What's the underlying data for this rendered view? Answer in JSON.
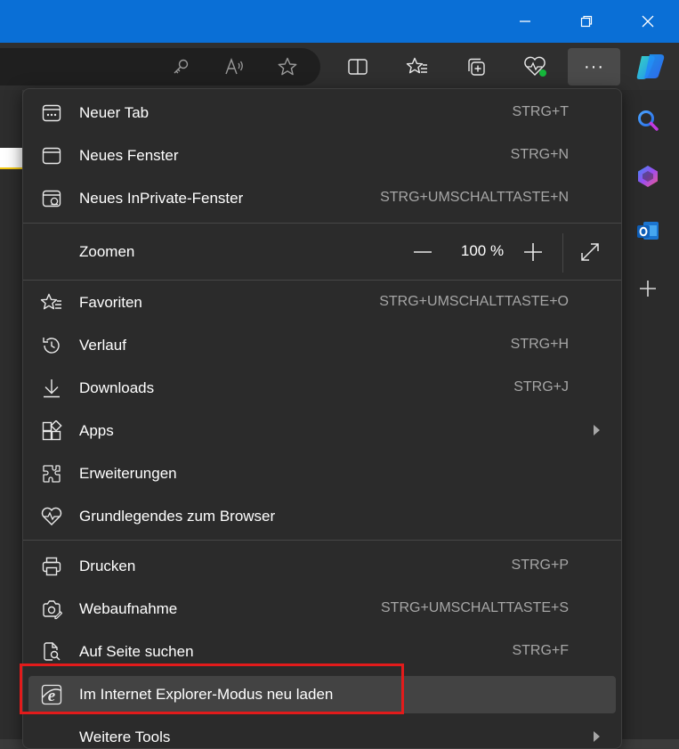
{
  "window": {
    "controls": [
      {
        "name": "minimize-icon"
      },
      {
        "name": "restore-icon"
      },
      {
        "name": "close-icon"
      }
    ]
  },
  "toolbar": {
    "address_icons": [
      "key-icon",
      "read-aloud-icon",
      "favorite-star-icon"
    ],
    "icons": [
      "split-screen-icon",
      "favorites-icon",
      "collections-icon",
      "browser-essentials-icon"
    ],
    "more_label": "···"
  },
  "sidebar": {
    "icons": [
      "copilot-icon",
      "search-icon",
      "bing-icon",
      "outlook-icon",
      "add-icon"
    ]
  },
  "menu": {
    "items": [
      {
        "label": "Neuer Tab",
        "shortcut": "STRG+T",
        "icon": "new-tab-icon"
      },
      {
        "label": "Neues Fenster",
        "shortcut": "STRG+N",
        "icon": "new-window-icon"
      },
      {
        "label": "Neues InPrivate-Fenster",
        "shortcut": "STRG+UMSCHALTTASTE+N",
        "icon": "inprivate-icon"
      }
    ],
    "zoom": {
      "label": "Zoomen",
      "value": "100 %",
      "minus": "—",
      "plus": "+"
    },
    "items2": [
      {
        "label": "Favoriten",
        "shortcut": "STRG+UMSCHALTTASTE+O",
        "icon": "favorites-icon"
      },
      {
        "label": "Verlauf",
        "shortcut": "STRG+H",
        "icon": "history-icon"
      },
      {
        "label": "Downloads",
        "shortcut": "STRG+J",
        "icon": "downloads-icon"
      },
      {
        "label": "Apps",
        "shortcut": "",
        "icon": "apps-icon"
      },
      {
        "label": "Erweiterungen",
        "shortcut": "",
        "icon": "extensions-icon"
      },
      {
        "label": "Grundlegendes zum Browser",
        "shortcut": "",
        "icon": "browser-essentials-icon"
      }
    ],
    "items3": [
      {
        "label": "Drucken",
        "shortcut": "STRG+P",
        "icon": "print-icon"
      },
      {
        "label": "Webaufnahme",
        "shortcut": "STRG+UMSCHALTTASTE+S",
        "icon": "web-capture-icon"
      },
      {
        "label": "Auf Seite suchen",
        "shortcut": "STRG+F",
        "icon": "find-on-page-icon"
      },
      {
        "label": "Im Internet Explorer-Modus neu laden",
        "shortcut": "",
        "icon": "ie-mode-icon"
      },
      {
        "label": "Weitere Tools",
        "shortcut": "",
        "icon": "more-tools-icon"
      }
    ]
  },
  "colors": {
    "titlebar": "#0a6fd6",
    "menu_bg": "#2b2b2b",
    "highlight": "#434343",
    "annotation": "#e21b1b"
  }
}
